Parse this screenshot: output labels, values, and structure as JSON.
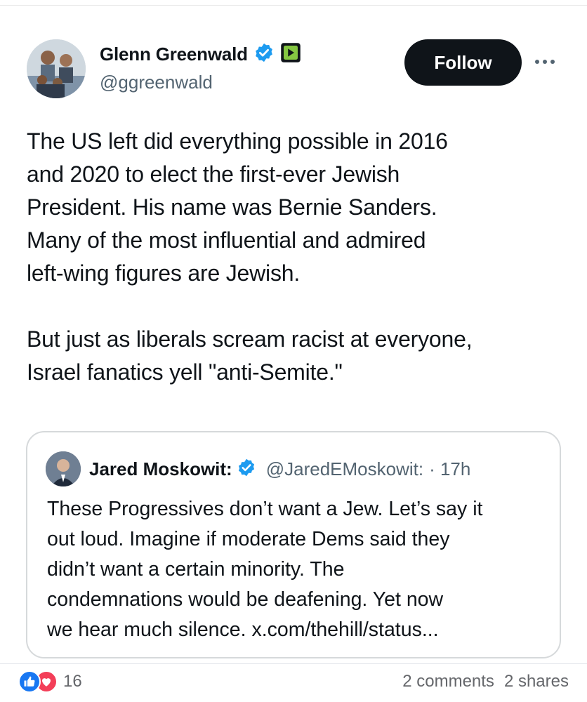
{
  "post": {
    "author_name": "Glenn Greenwald",
    "handle": "@ggreenwald",
    "follow_label": "Follow",
    "text": "The US left did everything possible in 2016\nand 2020 to elect the first-ever Jewish\nPresident. His name was Bernie Sanders.\nMany of the most influential and admired\nleft-wing figures are Jewish.\n\nBut just as liberals scream racist at everyone,\nIsrael fanatics yell \"anti-Semite.\"",
    "icons": [
      "verified-badge-icon",
      "rumble-icon",
      "more-icon"
    ]
  },
  "quote": {
    "author_name": "Jared Moskowit:",
    "handle": "@JaredEMoskowit:",
    "time": "· 17h",
    "text": "These Progressives don’t want a Jew. Let’s say it\nout loud. Imagine if moderate Dems said they\ndidn’t want a certain minority. The\ncondemnations would be deafening. Yet now\nwe hear much silence. x.com/thehill/status..."
  },
  "footer": {
    "reaction_count": "16",
    "comments": "2 comments",
    "shares": "2 shares",
    "icons": [
      "like-reaction-icon",
      "love-reaction-icon"
    ]
  },
  "colors": {
    "verified": "#1d9bf0",
    "rumble": "#85c742",
    "like": "#1877f2",
    "love": "#f33e58",
    "follow_bg": "#0f1419"
  }
}
